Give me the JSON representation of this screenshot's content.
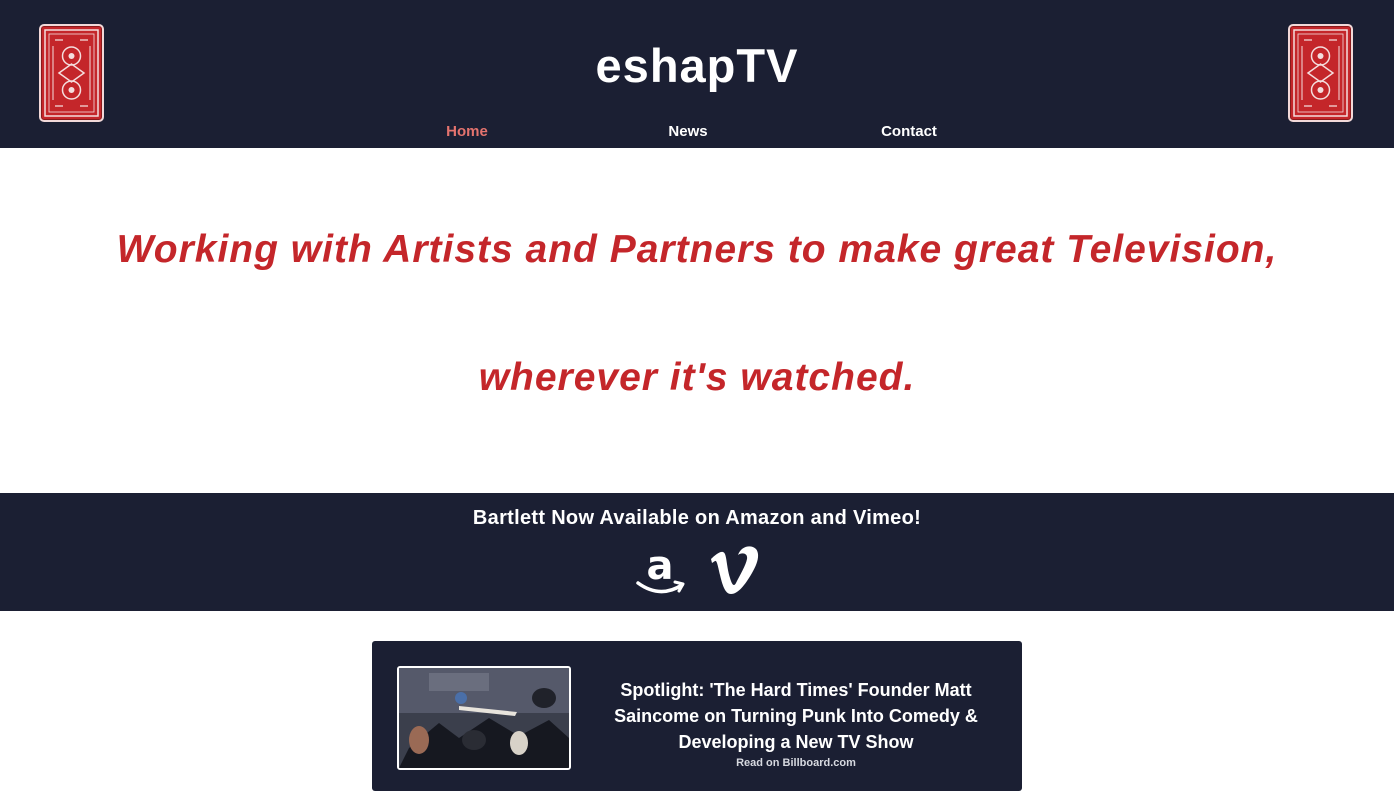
{
  "header": {
    "site_title": "eshapTV",
    "nav": [
      {
        "label": "Home",
        "active": true
      },
      {
        "label": "News",
        "active": false
      },
      {
        "label": "Contact",
        "active": false
      }
    ],
    "decor_icon": "playing-card-back-icon"
  },
  "hero": {
    "tagline_line1": "Working with Artists and Partners to make great Television,",
    "tagline_line2": "wherever it's watched."
  },
  "banner": {
    "title": "Bartlett Now Available on Amazon and Vimeo!",
    "platforms": [
      {
        "icon": "amazon-icon"
      },
      {
        "icon": "vimeo-icon"
      }
    ]
  },
  "news": {
    "headline": "Spotlight: 'The Hard Times' Founder Matt Saincome on Turning Punk Into Comedy & Developing a New TV Show",
    "source": "Read on Billboard.com"
  },
  "colors": {
    "navy": "#1b1f33",
    "accent_red": "#c4262a",
    "active_nav": "#e4736e",
    "white": "#ffffff"
  }
}
